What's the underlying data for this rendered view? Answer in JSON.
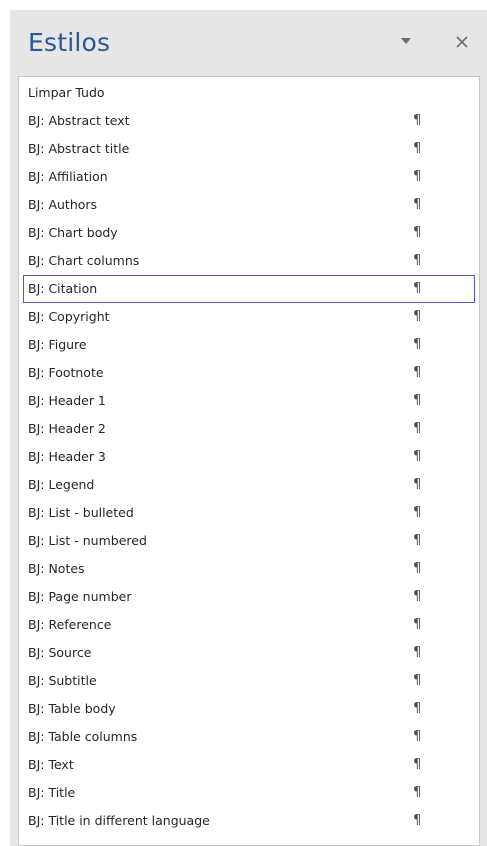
{
  "pane": {
    "title": "Estilos"
  },
  "colors": {
    "title": "#2b579a",
    "selection_border": "#4c5fc0",
    "pane_background": "#e6e6e6"
  },
  "icons": {
    "dropdown": "chevron-down-icon",
    "close": "close-icon",
    "paragraph_mark": "paragraph-mark-icon"
  },
  "styles": [
    {
      "label": "Limpar Tudo",
      "mark": ""
    },
    {
      "label": "BJ: Abstract text",
      "mark": "¶"
    },
    {
      "label": "BJ: Abstract title",
      "mark": "¶"
    },
    {
      "label": "BJ: Affiliation",
      "mark": "¶"
    },
    {
      "label": "BJ: Authors",
      "mark": "¶"
    },
    {
      "label": "BJ: Chart body",
      "mark": "¶"
    },
    {
      "label": "BJ: Chart columns",
      "mark": "¶"
    },
    {
      "label": "BJ: Citation",
      "mark": "¶"
    },
    {
      "label": "BJ: Copyright",
      "mark": "¶"
    },
    {
      "label": "BJ: Figure",
      "mark": "¶"
    },
    {
      "label": "BJ: Footnote",
      "mark": "¶"
    },
    {
      "label": "BJ: Header 1",
      "mark": "¶"
    },
    {
      "label": "BJ: Header 2",
      "mark": "¶"
    },
    {
      "label": "BJ: Header 3",
      "mark": "¶"
    },
    {
      "label": "BJ: Legend",
      "mark": "¶"
    },
    {
      "label": "BJ: List - bulleted",
      "mark": "¶"
    },
    {
      "label": "BJ: List - numbered",
      "mark": "¶"
    },
    {
      "label": "BJ: Notes",
      "mark": "¶"
    },
    {
      "label": "BJ: Page number",
      "mark": "¶"
    },
    {
      "label": "BJ: Reference",
      "mark": "¶"
    },
    {
      "label": "BJ: Source",
      "mark": "¶"
    },
    {
      "label": "BJ: Subtitle",
      "mark": "¶"
    },
    {
      "label": "BJ: Table body",
      "mark": "¶"
    },
    {
      "label": "BJ: Table columns",
      "mark": "¶"
    },
    {
      "label": "BJ: Text",
      "mark": "¶"
    },
    {
      "label": "BJ: Title",
      "mark": "¶"
    },
    {
      "label": "BJ: Title in different language",
      "mark": "¶"
    }
  ],
  "selected_style": "BJ: Citation"
}
